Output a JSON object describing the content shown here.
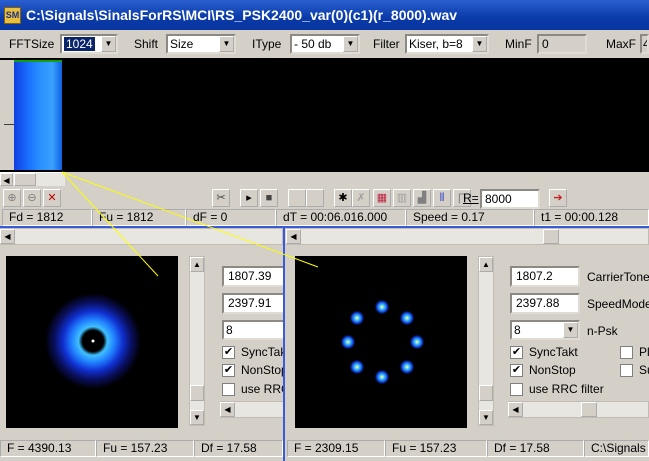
{
  "window": {
    "title": "C:\\Signals\\SinalsForRS\\MCI\\RS_PSK2400_var(0)(c1)(r_8000).wav",
    "app_icon_text": "SM"
  },
  "toolbar": {
    "fftsize_label": "FFTSize",
    "fftsize_value": "1024",
    "shift_label": "Shift",
    "shift_value": "Size",
    "itype_label": "IType",
    "itype_value": "- 50 db",
    "filter_label": "Filter",
    "filter_value": "Kiser, b=8",
    "minf_label": "MinF",
    "minf_value": "0",
    "maxf_label": "MaxF",
    "maxf_value": "4"
  },
  "toolbar2": {
    "r_label": "R=",
    "r_value": "8000"
  },
  "status": {
    "fd": "Fd = 1812",
    "fu": "Fu = 1812",
    "df": "dF = 0",
    "dt": "dT = 00:06.016.000",
    "speed": "Speed = 0.17",
    "t1": "t1 = 00:00.128"
  },
  "left_panel": {
    "freq1": "1807.39",
    "freq2": "2397.91",
    "npsk": "8",
    "sync_label": "SyncTakt",
    "nonstop_label": "NonStop",
    "rrc_label": "use RRC filter",
    "status_f": "F = 4390.13",
    "status_fu": "Fu = 157.23",
    "status_df": "Df = 17.58"
  },
  "right_panel": {
    "freq1": "1807.2",
    "freq1_label": "CarrierTone",
    "freq2": "2397.88",
    "freq2_label": "SpeedMode",
    "npsk": "8",
    "npsk_label": "n-Psk",
    "sync_label": "SyncTakt",
    "nonstop_label": "NonStop",
    "rrc_label": "use RRC filter",
    "pl_label": "Pl",
    "su_label": "Su",
    "status_f": "F = 2309.15",
    "status_fu": "Fu = 157.23",
    "status_df": "Df = 17.58",
    "status_path": "C:\\Signals"
  },
  "colors": {
    "title_bar": "#0a3aa8",
    "accent_line": "#3a5adc",
    "marker_line": "#ffff00"
  }
}
